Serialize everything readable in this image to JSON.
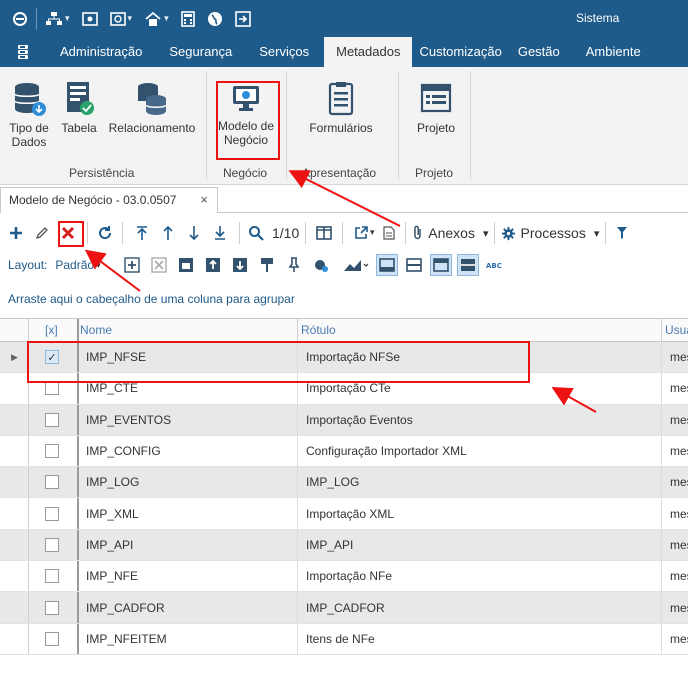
{
  "topbar": {
    "system_label": "Sistema"
  },
  "menu": {
    "items": [
      "Administração",
      "Segurança",
      "Serviços",
      "Metadados",
      "Customização",
      "Gestão",
      "Ambiente"
    ],
    "active_index": 3
  },
  "ribbon": {
    "persistencia": {
      "label": "Persistência",
      "tipo_de_dados": "Tipo de Dados",
      "tabela": "Tabela",
      "relacionamento": "Relacionamento"
    },
    "negocio": {
      "label": "Negócio",
      "modelo_de_negocio": "Modelo de Negócio"
    },
    "apresentacao": {
      "label": "Apresentação",
      "formularios": "Formulários"
    },
    "projeto": {
      "label": "Projeto",
      "projeto": "Projeto"
    }
  },
  "tab": {
    "title": "Modelo de Negócio - 03.0.0507",
    "close": "×"
  },
  "toolbar": {
    "page_indicator": "1/10",
    "anexos_label": "Anexos",
    "processos_label": "Processos"
  },
  "layoutbar": {
    "label": "Layout:",
    "value": "Padrão"
  },
  "grid": {
    "group_hint": "Arraste aqui o cabeçalho de uma coluna para agrupar",
    "columns": {
      "check": "[x]",
      "nome": "Nome",
      "rotulo": "Rótulo",
      "usuario": "Usuá"
    },
    "rows": [
      {
        "checked": true,
        "nome": "IMP_NFSE",
        "rotulo": "Importação NFSe",
        "usuario": "mes"
      },
      {
        "checked": false,
        "nome": "IMP_CTE",
        "rotulo": "Importação CTe",
        "usuario": "mes"
      },
      {
        "checked": false,
        "nome": "IMP_EVENTOS",
        "rotulo": "Importação Eventos",
        "usuario": "mes"
      },
      {
        "checked": false,
        "nome": "IMP_CONFIG",
        "rotulo": "Configuração Importador XML",
        "usuario": "mes"
      },
      {
        "checked": false,
        "nome": "IMP_LOG",
        "rotulo": "IMP_LOG",
        "usuario": "mes"
      },
      {
        "checked": false,
        "nome": "IMP_XML",
        "rotulo": "Importação XML",
        "usuario": "mes"
      },
      {
        "checked": false,
        "nome": "IMP_API",
        "rotulo": "IMP_API",
        "usuario": "mes"
      },
      {
        "checked": false,
        "nome": "IMP_NFE",
        "rotulo": "Importação NFe",
        "usuario": "mes"
      },
      {
        "checked": false,
        "nome": "IMP_CADFOR",
        "rotulo": "IMP_CADFOR",
        "usuario": "mes"
      },
      {
        "checked": false,
        "nome": "IMP_NFEITEM",
        "rotulo": "Itens de NFe",
        "usuario": "mes"
      }
    ]
  },
  "colors": {
    "brand": "#1e5a8a",
    "highlight": "#e11111"
  }
}
